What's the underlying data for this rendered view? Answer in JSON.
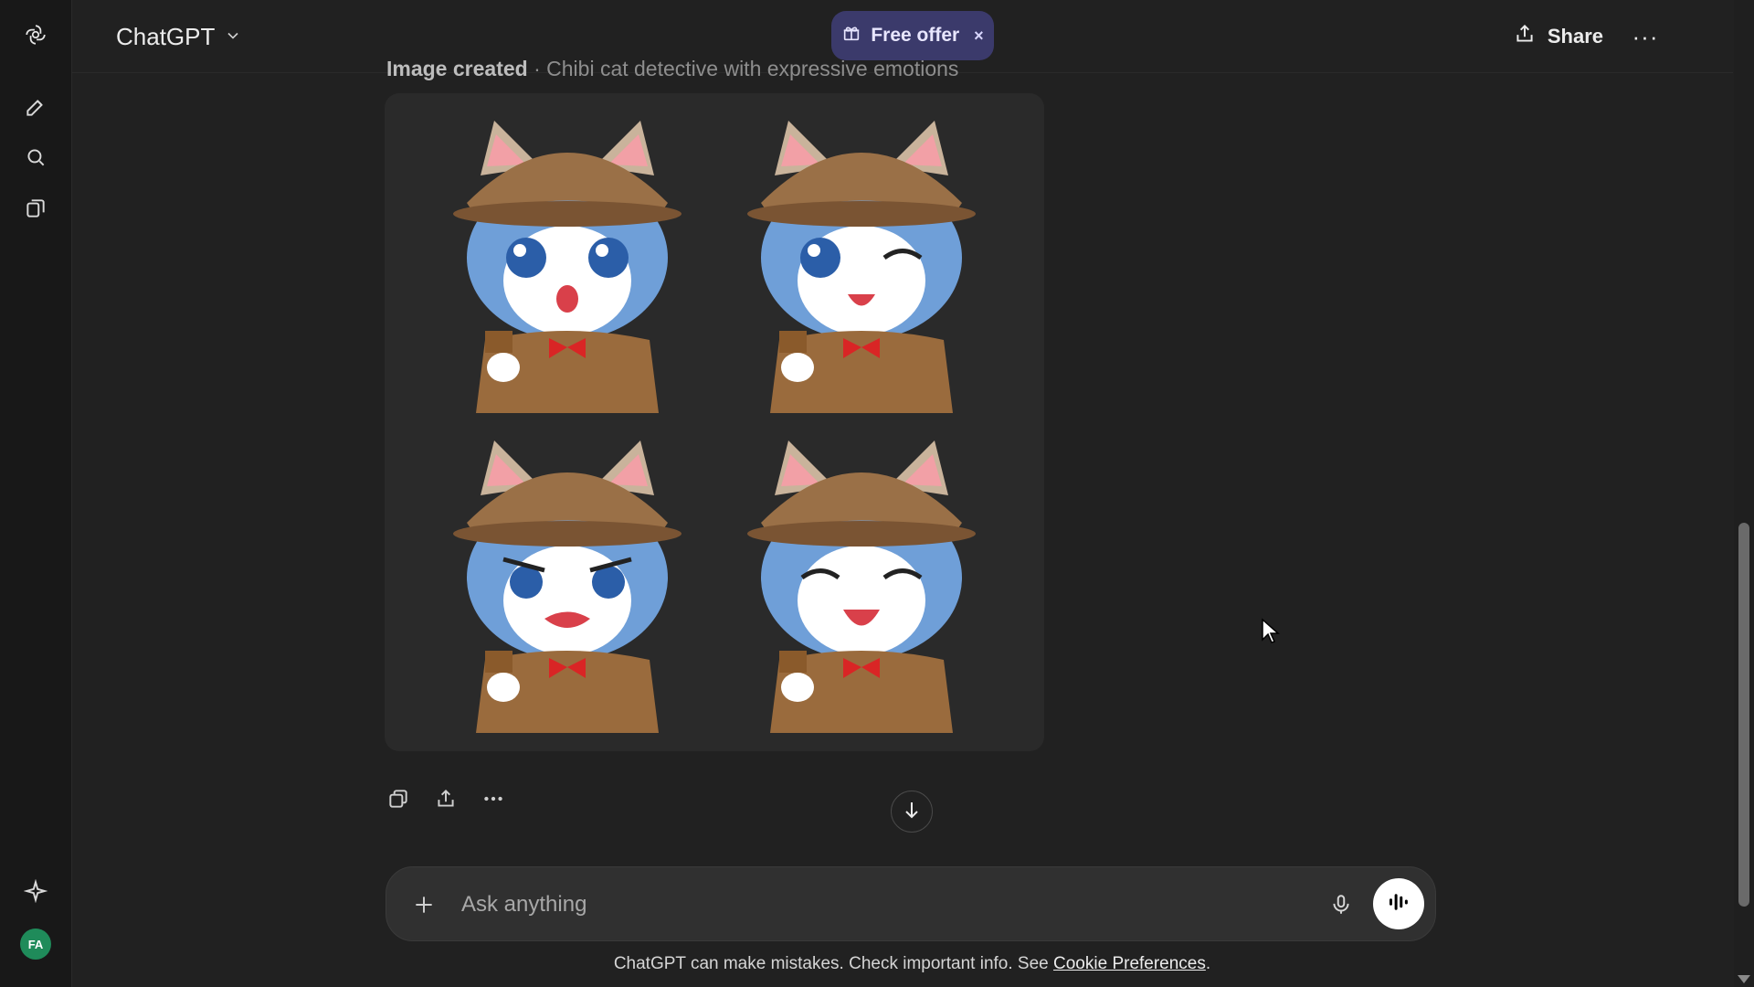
{
  "header": {
    "model_label": "ChatGPT",
    "offer_label": "Free offer",
    "offer_close": "×",
    "share_label": "Share",
    "more_label": "···"
  },
  "rail": {
    "icons": [
      "openai-logo-icon",
      "new-chat-icon",
      "search-icon",
      "library-icon",
      "upgrade-sparkle-icon"
    ],
    "avatar_initials": "FA"
  },
  "message": {
    "caption_bold": "Image created",
    "caption_rest": "· Chibi cat detective with expressive emotions",
    "images": [
      {
        "emotion": "surprised"
      },
      {
        "emotion": "winking"
      },
      {
        "emotion": "angry"
      },
      {
        "emotion": "happy"
      }
    ]
  },
  "composer": {
    "placeholder": "Ask anything"
  },
  "footer": {
    "disclaimer": "ChatGPT can make mistakes. Check important info. See ",
    "link": "Cookie Preferences",
    "period": "."
  },
  "colors": {
    "background": "#212121",
    "rail": "#181818",
    "offer_pill": "#3b3a6b",
    "avatar": "#1f8b5a"
  }
}
